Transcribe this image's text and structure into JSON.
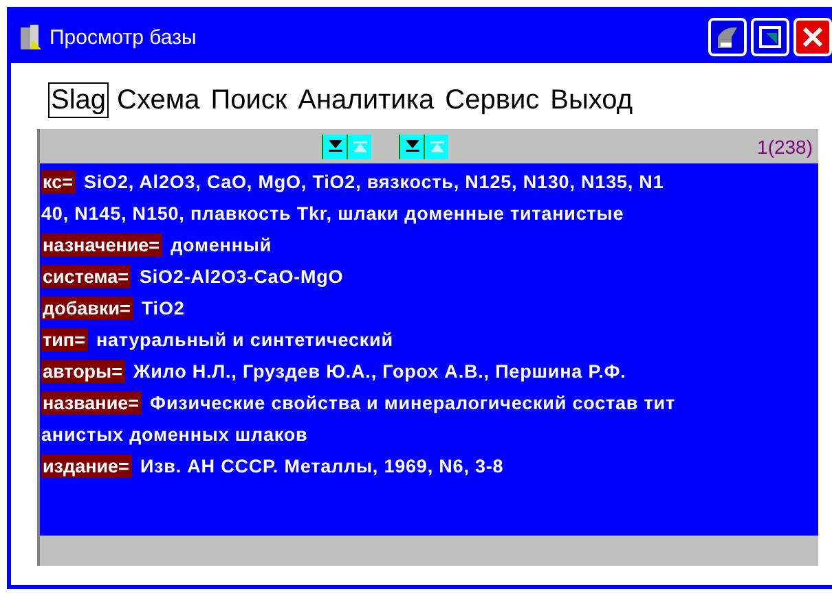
{
  "window": {
    "title": "Просмотр базы"
  },
  "menu": [
    {
      "label": "Slag",
      "selected": true
    },
    {
      "label": "Схема",
      "selected": false
    },
    {
      "label": "Поиск",
      "selected": false
    },
    {
      "label": "Аналитика",
      "selected": false
    },
    {
      "label": "Сервис",
      "selected": false
    },
    {
      "label": "Выход",
      "selected": false
    }
  ],
  "navigator": {
    "buttons": [
      {
        "kind": "down",
        "disabled": false
      },
      {
        "kind": "up",
        "disabled": true
      },
      {
        "kind": "down",
        "disabled": false
      },
      {
        "kind": "up",
        "disabled": true
      }
    ],
    "counter": "1(238)"
  },
  "fields": [
    {
      "label": "кс=",
      "lines": [
        "SiO2, Al2O3, CaO, MgO, TiO2, вязкость, N125, N130, N135, N1",
        "40, N145, N150, плавкость Tkr, шлаки доменные титанистые"
      ]
    },
    {
      "label": "назначение=",
      "lines": [
        "доменный"
      ]
    },
    {
      "label": "система=",
      "lines": [
        "SiO2-Al2O3-CaO-MgO"
      ]
    },
    {
      "label": "добавки=",
      "lines": [
        "TiO2"
      ]
    },
    {
      "label": "тип=",
      "lines": [
        "натуральный и синтетический"
      ]
    },
    {
      "label": "авторы=",
      "lines": [
        "Жило Н.Л., Груздев Ю.А., Горох А.В., Першина Р.Ф."
      ]
    },
    {
      "label": "название=",
      "lines": [
        "Физические свойства и минералогический состав тит",
        "анистых доменных шлаков"
      ]
    },
    {
      "label": "издание=",
      "lines": [
        "Изв. АН СССР. Металлы, 1969, N6, 3-8"
      ]
    }
  ]
}
